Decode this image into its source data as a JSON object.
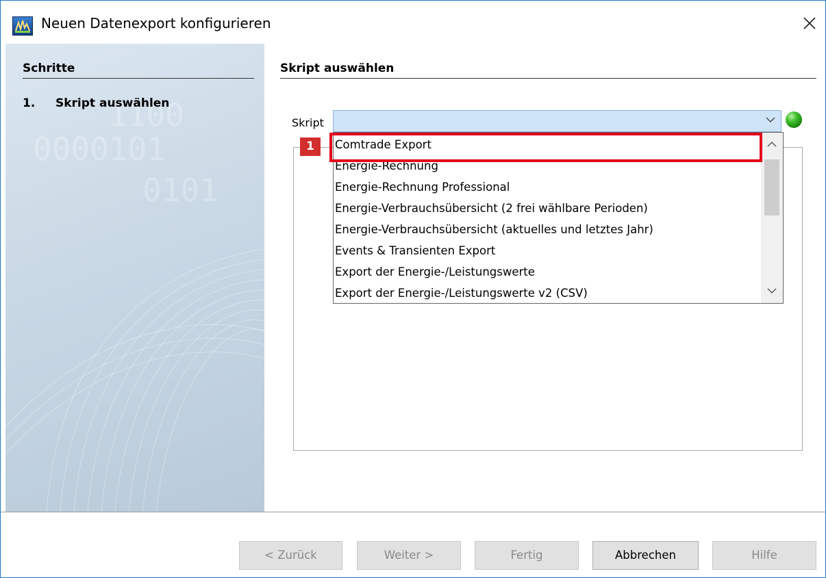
{
  "window": {
    "title": "Neuen Datenexport konfigurieren",
    "icon": "app-logo-icon",
    "close_icon": "close-icon"
  },
  "sidebar": {
    "heading": "Schritte",
    "steps": [
      {
        "number": "1.",
        "label": "Skript auswählen"
      }
    ]
  },
  "main": {
    "heading": "Skript auswählen",
    "script_label": "Skript",
    "script_value": "",
    "status_color": "#2ea31e",
    "dropdown_items": [
      "Comtrade Export",
      "Energie-Rechnung",
      "Energie-Rechnung Professional",
      "Energie-Verbrauchsübersicht (2 frei wählbare Perioden)",
      "Energie-Verbrauchsübersicht (aktuelles und letztes Jahr)",
      "Events & Transienten Export",
      "Export der Energie-/Leistungswerte",
      "Export der Energie-/Leistungswerte v2 (CSV)"
    ]
  },
  "annotation": {
    "callout_number": "1",
    "highlight_color": "#e3001b"
  },
  "buttons": {
    "back": "< Zurück",
    "next": "Weiter >",
    "finish": "Fertig",
    "cancel": "Abbrechen",
    "help": "Hilfe"
  }
}
